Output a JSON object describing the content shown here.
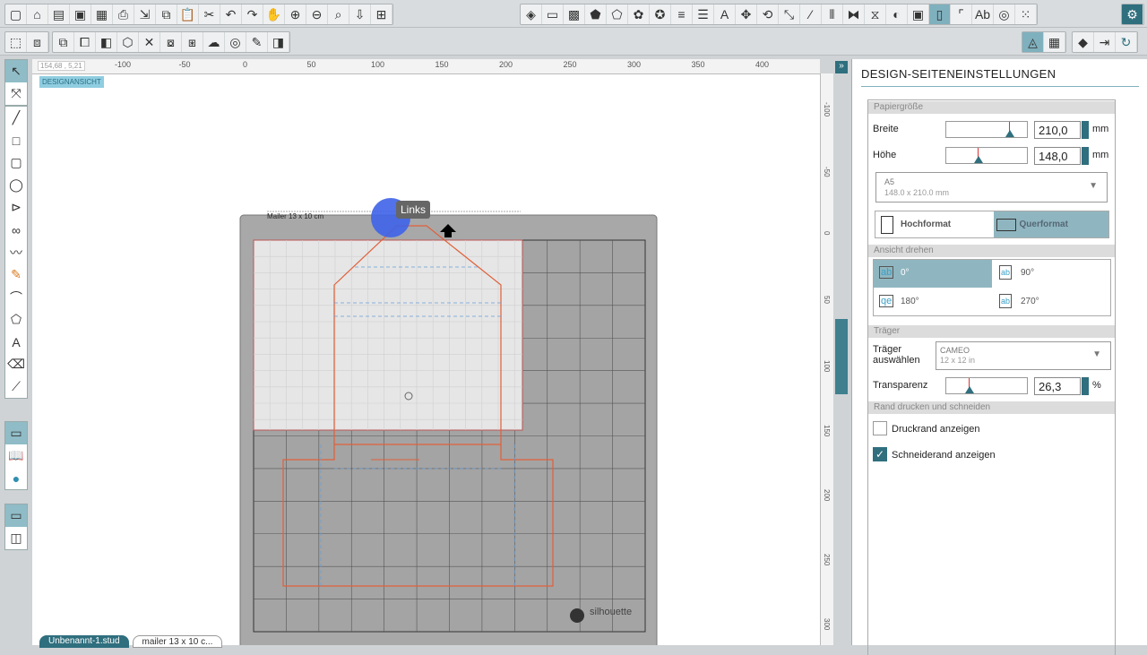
{
  "coords": "154,68 , 5,21",
  "view_label": "DESIGNANSICHT",
  "ruler_h": [
    "-100",
    "-50",
    "0",
    "50",
    "100",
    "150",
    "200",
    "250",
    "300",
    "350",
    "400"
  ],
  "ruler_v": [
    "-100",
    "-50",
    "0",
    "50",
    "100",
    "150",
    "200",
    "250",
    "300"
  ],
  "canvas": {
    "doc_title": "Mailer 13 x 10 cm",
    "tooltip": "Links",
    "brand": "silhouette"
  },
  "tabs": [
    "Unbenannt-1.stud",
    "mailer 13 x 10 c..."
  ],
  "panel": {
    "title": "DESIGN-SEITENEINSTELLUNGEN",
    "paper_section": "Papiergröße",
    "width_label": "Breite",
    "width_value": "210,0",
    "unit_mm": "mm",
    "height_label": "Höhe",
    "height_value": "148,0",
    "paper_name": "A5",
    "paper_dims": "148.0 x 210.0 mm",
    "portrait": "Hochformat",
    "landscape": "Querformat",
    "rotate_section": "Ansicht drehen",
    "rotations": [
      "0°",
      "90°",
      "180°",
      "270°"
    ],
    "mat_section": "Träger",
    "mat_label": "Träger auswählen",
    "mat_name": "CAMEO",
    "mat_dims": "12 x 12 in",
    "transparency_label": "Transparenz",
    "transparency_value": "26,3",
    "unit_pct": "%",
    "border_section": "Rand drucken und schneiden",
    "print_border": "Druckrand anzeigen",
    "print_border_checked": false,
    "cut_border": "Schneiderand anzeigen",
    "cut_border_checked": true
  },
  "colors": {
    "accent": "#7fb0bd",
    "dark_accent": "#2f6f7e",
    "cut_line": "#e0603a",
    "mat": "#a8a8a8"
  }
}
